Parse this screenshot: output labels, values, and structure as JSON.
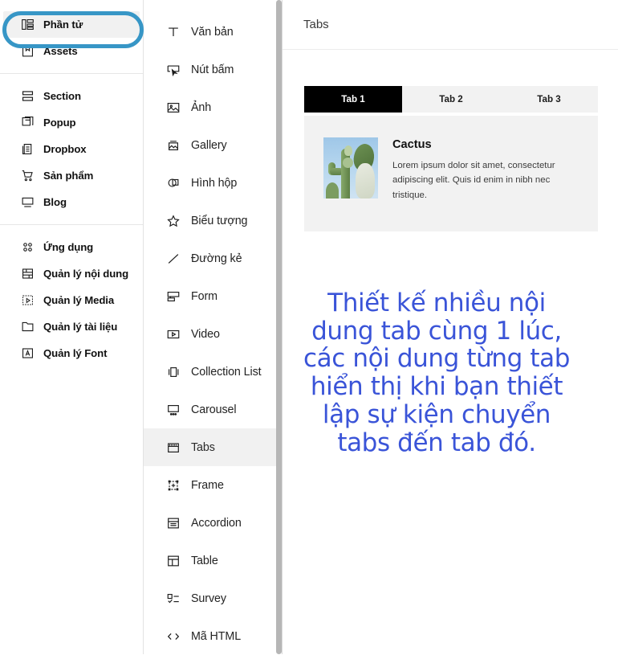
{
  "colors": {
    "highlight_ring": "#3796c6",
    "annotation_blue": "#3a54d8",
    "active_tab_bg": "#000000",
    "panel_bg": "#f2f2f2",
    "selected_item_bg": "#f1f1f1"
  },
  "sidebar": {
    "groups": [
      {
        "items": [
          {
            "label": "Phần tử",
            "icon": "elements-grid-icon",
            "selected": true
          },
          {
            "label": "Assets",
            "icon": "bookmark-icon",
            "selected": false
          }
        ]
      },
      {
        "items": [
          {
            "label": "Section",
            "icon": "section-rows-icon",
            "selected": false
          },
          {
            "label": "Popup",
            "icon": "popup-window-icon",
            "selected": false
          },
          {
            "label": "Dropbox",
            "icon": "dropbox-list-icon",
            "selected": false
          },
          {
            "label": "Sản phẩm",
            "icon": "shopping-cart-icon",
            "selected": false
          },
          {
            "label": "Blog",
            "icon": "monitor-icon",
            "selected": false
          }
        ]
      },
      {
        "items": [
          {
            "label": "Ứng dụng",
            "icon": "apps-dots-icon",
            "selected": false
          },
          {
            "label": "Quản lý nội dung",
            "icon": "content-manager-icon",
            "selected": false
          },
          {
            "label": "Quản lý Media",
            "icon": "media-manager-icon",
            "selected": false
          },
          {
            "label": "Quản lý tài liệu",
            "icon": "folder-icon",
            "selected": false
          },
          {
            "label": "Quản lý Font",
            "icon": "font-letter-a-icon",
            "selected": false
          }
        ]
      }
    ]
  },
  "element_list": {
    "items": [
      {
        "label": "Văn bản",
        "icon": "text-t-icon",
        "selected": false
      },
      {
        "label": "Nút bấm",
        "icon": "button-cursor-icon",
        "selected": false
      },
      {
        "label": "Ảnh",
        "icon": "image-icon",
        "selected": false
      },
      {
        "label": "Gallery",
        "icon": "gallery-icon",
        "selected": false
      },
      {
        "label": "Hình hộp",
        "icon": "shapes-overlap-icon",
        "selected": false
      },
      {
        "label": "Biểu tượng",
        "icon": "star-icon",
        "selected": false
      },
      {
        "label": "Đường kẻ",
        "icon": "line-diagonal-icon",
        "selected": false
      },
      {
        "label": "Form",
        "icon": "form-icon",
        "selected": false
      },
      {
        "label": "Video",
        "icon": "video-play-icon",
        "selected": false
      },
      {
        "label": "Collection List",
        "icon": "collection-list-icon",
        "selected": false
      },
      {
        "label": "Carousel",
        "icon": "carousel-icon",
        "selected": false
      },
      {
        "label": "Tabs",
        "icon": "tabs-icon",
        "selected": true
      },
      {
        "label": "Frame",
        "icon": "frame-icon",
        "selected": false
      },
      {
        "label": "Accordion",
        "icon": "accordion-icon",
        "selected": false
      },
      {
        "label": "Table",
        "icon": "table-grid-icon",
        "selected": false
      },
      {
        "label": "Survey",
        "icon": "survey-checklist-icon",
        "selected": false
      },
      {
        "label": "Mã HTML",
        "icon": "code-brackets-icon",
        "selected": false
      }
    ]
  },
  "preview": {
    "header_title": "Tabs",
    "tabs": [
      {
        "label": "Tab 1",
        "active": true
      },
      {
        "label": "Tab 2",
        "active": false
      },
      {
        "label": "Tab 3",
        "active": false
      }
    ],
    "card": {
      "image_alt": "cactus-photo",
      "title": "Cactus",
      "description": "Lorem ipsum dolor sit amet, consectetur adipiscing elit. Quis id enim in nibh nec tristique."
    }
  },
  "annotation": {
    "lines": [
      "Thiết kế nhiều nội",
      "dung tab cùng 1 lúc,",
      "các nội dung từng tab",
      "hiển thị khi bạn thiết",
      "lập sự kiện chuyển",
      "tabs đến tab đó."
    ]
  }
}
